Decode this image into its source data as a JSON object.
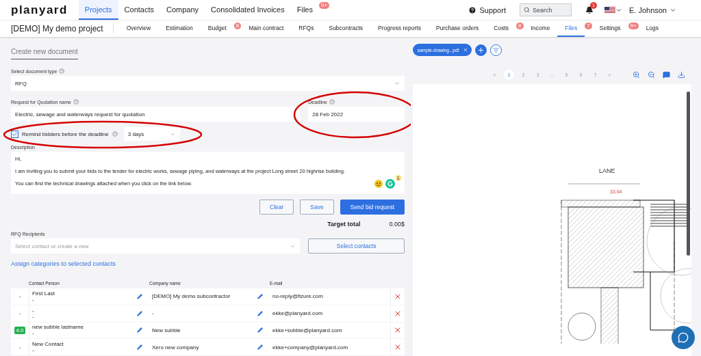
{
  "logo": "planyard",
  "main_nav": [
    {
      "label": "Projects",
      "selected": true
    },
    {
      "label": "Contacts",
      "selected": false
    },
    {
      "label": "Company",
      "selected": false
    },
    {
      "label": "Consolidated Invoices",
      "selected": false
    },
    {
      "label": "Files",
      "selected": false,
      "badge": "9+"
    }
  ],
  "header_right": {
    "support": "Support",
    "search_placeholder": "Search",
    "notifications": "1",
    "user": "E. Johnson"
  },
  "project": {
    "title": "[DEMO] My demo project",
    "tabs": [
      {
        "label": "Overview",
        "selected": false
      },
      {
        "label": "Estimation",
        "selected": false
      },
      {
        "label": "Budget",
        "selected": false,
        "badge": "8"
      },
      {
        "label": "Main contract",
        "selected": false
      },
      {
        "label": "RFQs",
        "selected": false
      },
      {
        "label": "Subcontracts",
        "selected": false
      },
      {
        "label": "Progress reports",
        "selected": false
      },
      {
        "label": "Purchase orders",
        "selected": false
      },
      {
        "label": "Costs",
        "selected": false,
        "badge": "8"
      },
      {
        "label": "Income",
        "selected": false
      },
      {
        "label": "Files",
        "selected": true,
        "badge": "7"
      },
      {
        "label": "Settings",
        "selected": false,
        "badge": "9+"
      },
      {
        "label": "Logs",
        "selected": false
      }
    ]
  },
  "form": {
    "heading": "Create new document",
    "doc_type": {
      "label": "Select document type",
      "value": "RFQ"
    },
    "name": {
      "label": "Request for Quotation name",
      "value": "Electric, sewage and waterways request for quotation"
    },
    "deadline": {
      "label": "Deadline",
      "value": "28 Feb 2022"
    },
    "remind": {
      "label": "Remind bidders before the deadline",
      "checked": true,
      "value": "3 days"
    },
    "description": {
      "label": "Description",
      "lines": [
        "Hi,",
        "I am inviting you to submit your bids to the tender for electric works, sewage piping, and waterways at the project Long street 20 highrise building.",
        "You can find the technical drawings attached when you click on the link below."
      ],
      "grammar_count": "1"
    },
    "buttons": {
      "clear": "Clear",
      "save": "Save",
      "send": "Send bid request"
    },
    "target_total": {
      "label": "Target total",
      "value": "0.00$"
    },
    "recipients": {
      "label": "RFQ Recipients",
      "placeholder": "Select contact or create a new",
      "button": "Select contacts"
    },
    "assign_link": "Assign categories to selected contacts"
  },
  "table": {
    "columns": [
      "Contact Person",
      "Company name",
      "E-mail"
    ],
    "rows": [
      {
        "kind": "unrated",
        "score": "-",
        "person": "First Last",
        "person_sub": "-",
        "company": "[DEMO] My demo subcontractor",
        "email": "no-reply@fizure.com"
      },
      {
        "kind": "unrated",
        "score": "-",
        "person": "-",
        "person_sub": "-",
        "company": "-",
        "email": "ekke@planyard.com"
      },
      {
        "kind": "rated",
        "score": "4.0",
        "person": "new subbie lastname",
        "person_sub": "-",
        "company": "New subbie",
        "email": "ekke+subbie@planyard.com"
      },
      {
        "kind": "unrated",
        "score": "-",
        "person": "New Contact",
        "person_sub": "-",
        "company": "Xero new company",
        "email": "ekke+company@planyard.com"
      }
    ]
  },
  "viewer": {
    "file_chip": "sample-drawing...pdf",
    "pages": [
      {
        "label": "<",
        "selected": false
      },
      {
        "label": "1",
        "selected": true
      },
      {
        "label": "2",
        "selected": false
      },
      {
        "label": "3",
        "selected": false
      },
      {
        "label": "...",
        "selected": false
      },
      {
        "label": "5",
        "selected": false
      },
      {
        "label": "6",
        "selected": false
      },
      {
        "label": "7",
        "selected": false
      },
      {
        "label": ">",
        "selected": false
      }
    ],
    "plan_labels": [
      "LANE",
      "33.04"
    ]
  }
}
